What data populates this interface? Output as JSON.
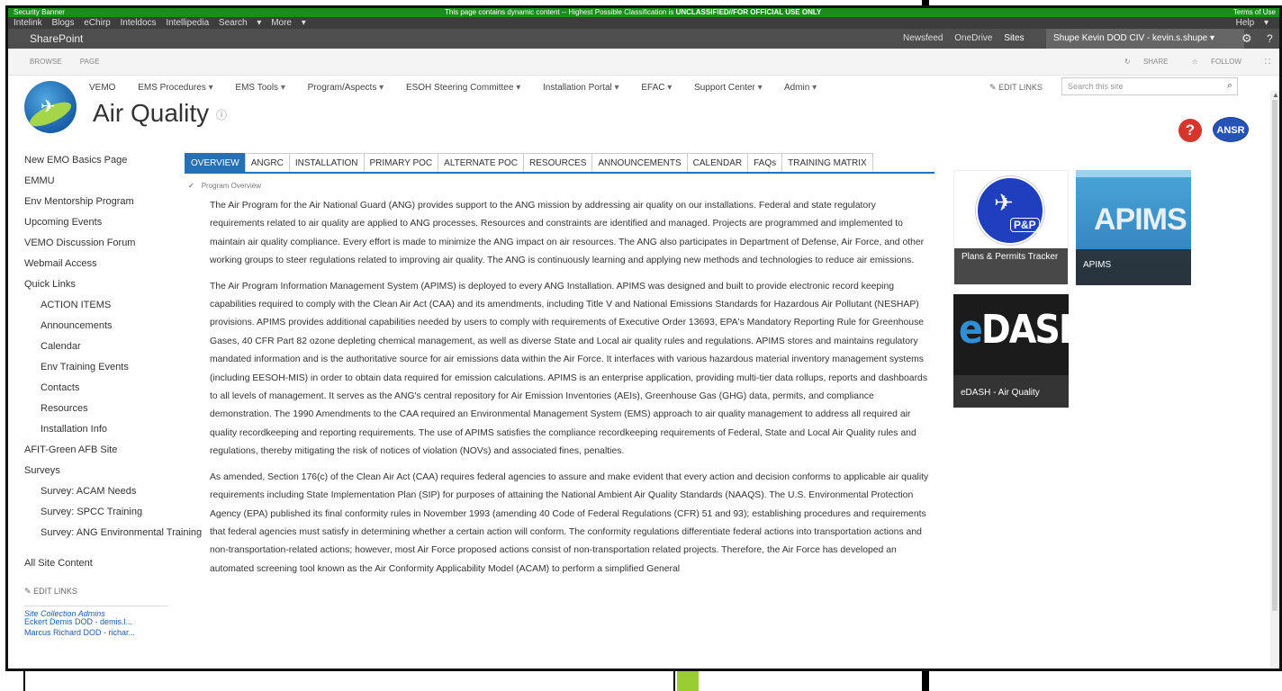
{
  "banner": {
    "left": "Security Banner",
    "center_text": "This page contains dynamic content -- Highest Possible Classification is ",
    "center_bold": "UNCLASSIFIED//FOR OFFICIAL USE ONLY",
    "right": "Terms of Use"
  },
  "intelink": {
    "items": [
      "Intelink",
      "Blogs",
      "eChirp",
      "Inteldocs",
      "Intellipedia",
      "Search",
      "More"
    ],
    "help": "Help"
  },
  "suitebar": {
    "brand": "SharePoint",
    "links": [
      "Newsfeed",
      "OneDrive",
      "Sites"
    ],
    "user": "Shupe Kevin DOD CIV - kevin.s.shupe",
    "gear_icon": "gear-icon",
    "help_mark": "?"
  },
  "ribbon": {
    "tabs": [
      "BROWSE",
      "PAGE"
    ],
    "share": "SHARE",
    "follow": "FOLLOW"
  },
  "topnav": {
    "items": [
      "VEMO",
      "EMS Procedures",
      "EMS Tools",
      "Program/Aspects",
      "ESOH Steering Committee",
      "Installation Portal",
      "EFAC",
      "Support Center",
      "Admin"
    ],
    "edit_links": "EDIT LINKS",
    "search_placeholder": "Search this site"
  },
  "site": {
    "title": "Air Quality",
    "info_icon": "info-icon",
    "help_icon": "?",
    "ansr_label": "ANSR"
  },
  "leftnav": {
    "items": [
      {
        "label": "New EMO Basics Page",
        "level": 0
      },
      {
        "label": "EMMU",
        "level": 0
      },
      {
        "label": "Env Mentorship Program",
        "level": 0
      },
      {
        "label": "Upcoming Events",
        "level": 0
      },
      {
        "label": "VEMO Discussion Forum",
        "level": 0
      },
      {
        "label": "Webmail Access",
        "level": 0
      },
      {
        "label": "Quick Links",
        "level": 0
      },
      {
        "label": "ACTION ITEMS",
        "level": 1
      },
      {
        "label": "Announcements",
        "level": 1
      },
      {
        "label": "Calendar",
        "level": 1
      },
      {
        "label": "Env Training Events",
        "level": 1
      },
      {
        "label": "Contacts",
        "level": 1
      },
      {
        "label": "Resources",
        "level": 1
      },
      {
        "label": "Installation Info",
        "level": 1
      },
      {
        "label": "AFIT-Green AFB Site",
        "level": 0
      },
      {
        "label": "Surveys",
        "level": 0
      },
      {
        "label": "Survey: ACAM Needs",
        "level": 1
      },
      {
        "label": "Survey: SPCC Training",
        "level": 1
      },
      {
        "label": "Survey: ANG Environmental Training",
        "level": 1
      },
      {
        "label": "All Site Content",
        "level": 0
      }
    ],
    "edit_links": "EDIT LINKS",
    "admins_header": "Site Collection Admins",
    "admins": [
      "Eckert Demis DOD - demis.l...",
      "Marcus Richard DOD - richar..."
    ]
  },
  "tabs": {
    "items": [
      "OVERVIEW",
      "ANGRC",
      "INSTALLATION",
      "PRIMARY POC",
      "ALTERNATE POC",
      "RESOURCES",
      "ANNOUNCEMENTS",
      "CALENDAR",
      "FAQs",
      "TRAINING MATRIX"
    ],
    "active": 0
  },
  "crumb": "Program Overview",
  "content": {
    "paragraphs": [
      "The Air Program for the Air National Guard (ANG) provides support to the ANG mission by addressing air quality on our installations.  Federal and state regulatory requirements related to air quality are applied to ANG processes.  Resources and constraints are identified and managed. Projects are programmed and implemented to maintain air quality compliance.  Every effort is made to minimize the ANG impact on air resources. The ANG also participates in Department of Defense, Air Force, and other working groups to steer regulations related to improving air quality.  The ANG is continuously learning and applying new methods and technologies to reduce air emissions.",
      "The Air Program Information Management System (APIMS) is deployed to every ANG Installation. APIMS was designed and built to provide electronic record keeping capabilities required to comply with the Clean Air Act (CAA) and its amendments, including Title V and National Emissions Standards for Hazardous Air Pollutant (NESHAP) provisions.  APIMS provides additional capabilities needed by users to comply with requirements of Executive Order 13693, EPA's Mandatory Reporting Rule for Greenhouse Gases, 40 CFR Part 82 ozone depleting chemical management, as well as diverse State and Local air quality rules and regulations. APIMS stores and maintains regulatory mandated information and is the authoritative source for air emissions data within the Air Force. It interfaces with various hazardous material inventory management systems (including EESOH-MIS) in order to obtain data required for emission calculations. APIMS is an enterprise application, providing multi-tier data rollups, reports and dashboards to all levels of management. It serves as the ANG's central repository for Air Emission Inventories (AEIs), Greenhouse Gas (GHG) data, permits, and compliance demonstration. The 1990 Amendments to the CAA required an Environmental Management System (EMS) approach to air quality management to address all required air quality recordkeeping and reporting requirements. The use of APIMS satisfies the compliance recordkeeping requirements of Federal, State and Local Air Quality rules and regulations, thereby mitigating the risk of notices of violation (NOVs) and associated fines, penalties.",
      "As amended, Section 176(c) of the Clean Air Act (CAA) requires federal agencies to assure and make evident that every action and decision conforms to applicable air quality requirements including State Implementation Plan (SIP) for purposes of attaining the National Ambient Air Quality Standards (NAAQS). The U.S. Environmental Protection Agency (EPA) published its final conformity rules in November 1993 (amending 40 Code of Federal Regulations (CFR) 51 and 93); establishing procedures and requirements that federal agencies must satisfy in determining whether a certain action will conform. The conformity regulations differentiate federal actions into transportation actions and non-transportation-related actions; however, most Air Force proposed actions consist of non-transportation related projects. Therefore, the Air Force has developed an automated screening tool known as the Air Conformity Applicability Model (ACAM) to perform a simplified General"
    ]
  },
  "tiles": {
    "pp": {
      "logo_text": "P&P",
      "caption": "Plans & Permits Tracker"
    },
    "apims": {
      "logo_text": "APIMS",
      "caption": "APIMS"
    },
    "edash": {
      "logo_e": "e",
      "logo_rest": "DASH",
      "caption": "eDASH - Air Quality"
    }
  },
  "colors": {
    "banner": "#1c8c1c",
    "tab_active": "#2471b5",
    "suite": "#4e4e4e"
  }
}
